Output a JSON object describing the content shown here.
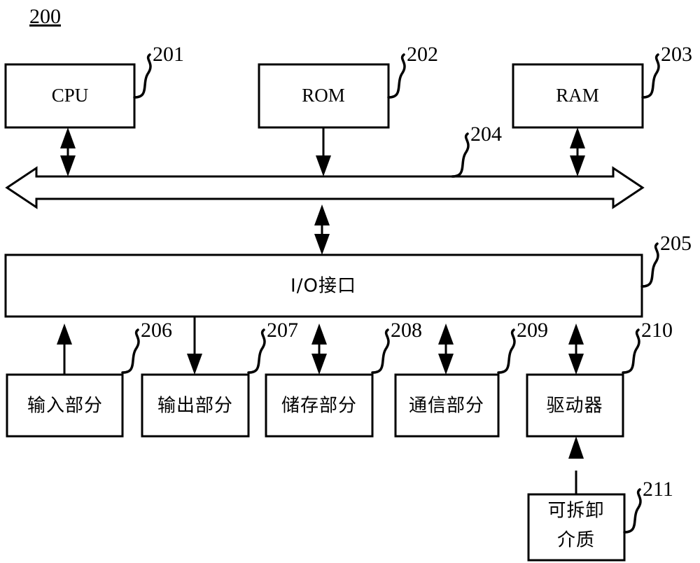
{
  "figure": {
    "number": "200",
    "type": "block-diagram",
    "description": "Computer system architecture block diagram"
  },
  "blocks": [
    {
      "id": "cpu",
      "label": "CPU",
      "ref": "201",
      "lines": [
        "CPU"
      ],
      "script": "latin"
    },
    {
      "id": "rom",
      "label": "ROM",
      "ref": "202",
      "lines": [
        "ROM"
      ],
      "script": "latin"
    },
    {
      "id": "ram",
      "label": "RAM",
      "ref": "203",
      "lines": [
        "RAM"
      ],
      "script": "latin"
    },
    {
      "id": "bus",
      "label": "",
      "ref": "204",
      "lines": [],
      "script": "none"
    },
    {
      "id": "io",
      "label": "I/O接口",
      "ref": "205",
      "lines": [
        "I/O接口"
      ],
      "script": "mixed"
    },
    {
      "id": "input",
      "label": "输入部分",
      "ref": "206",
      "lines": [
        "输入部分"
      ],
      "script": "cjk"
    },
    {
      "id": "output",
      "label": "输出部分",
      "ref": "207",
      "lines": [
        "输出部分"
      ],
      "script": "cjk"
    },
    {
      "id": "storage",
      "label": "储存部分",
      "ref": "208",
      "lines": [
        "储存部分"
      ],
      "script": "cjk"
    },
    {
      "id": "comm",
      "label": "通信部分",
      "ref": "209",
      "lines": [
        "通信部分"
      ],
      "script": "cjk"
    },
    {
      "id": "driver",
      "label": "驱动器",
      "ref": "210",
      "lines": [
        "驱动器"
      ],
      "script": "cjk"
    },
    {
      "id": "media",
      "label": "可拆卸介质",
      "ref": "211",
      "lines": [
        "可拆卸",
        "介质"
      ],
      "script": "cjk"
    }
  ],
  "labels": {
    "figure_number": "200",
    "cpu": "CPU",
    "rom": "ROM",
    "ram": "RAM",
    "io_interface": "I/O接口",
    "input_section": "输入部分",
    "output_section": "输出部分",
    "storage_section": "储存部分",
    "communication_section": "通信部分",
    "driver": "驱动器",
    "removable_media_line1": "可拆卸",
    "removable_media_line2": "介质"
  },
  "reference_numerals": {
    "figure": "200",
    "cpu": "201",
    "rom": "202",
    "ram": "203",
    "bus": "204",
    "io_interface": "205",
    "input_section": "206",
    "output_section": "207",
    "storage_section": "208",
    "communication_section": "209",
    "driver": "210",
    "removable_media": "211"
  },
  "connections": [
    {
      "from": "cpu",
      "to": "bus",
      "arrow": "bidirectional"
    },
    {
      "from": "rom",
      "to": "bus",
      "arrow": "down"
    },
    {
      "from": "ram",
      "to": "bus",
      "arrow": "bidirectional"
    },
    {
      "from": "bus",
      "to": "io",
      "arrow": "bidirectional"
    },
    {
      "from": "io",
      "to": "input",
      "arrow": "up"
    },
    {
      "from": "io",
      "to": "output",
      "arrow": "down"
    },
    {
      "from": "io",
      "to": "storage",
      "arrow": "bidirectional"
    },
    {
      "from": "io",
      "to": "comm",
      "arrow": "bidirectional"
    },
    {
      "from": "io",
      "to": "driver",
      "arrow": "bidirectional"
    },
    {
      "from": "media",
      "to": "driver",
      "arrow": "up"
    }
  ],
  "colors": {
    "background": "#ffffff",
    "stroke": "#000000",
    "text": "#000000"
  }
}
